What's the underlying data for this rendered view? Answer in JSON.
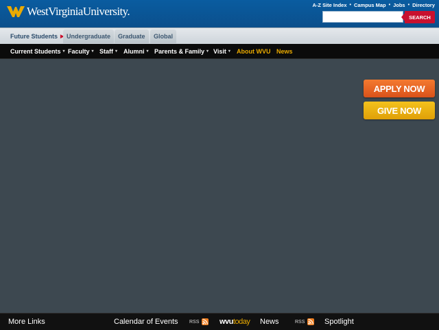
{
  "header": {
    "logo_text": "WestVirginiaUniversity.",
    "util_links": [
      "A-Z Site Index",
      "Campus Map",
      "Jobs",
      "Directory"
    ],
    "search": {
      "placeholder": "",
      "button_label": "SEARCH"
    }
  },
  "audience_tabs": [
    "Future Students",
    "Undergraduate",
    "Graduate",
    "Global"
  ],
  "main_nav": [
    {
      "label": "Current Students",
      "dropdown": true
    },
    {
      "label": "Faculty",
      "dropdown": true
    },
    {
      "label": "Staff",
      "dropdown": true
    },
    {
      "label": "Alumni",
      "dropdown": true
    },
    {
      "label": "Parents & Family",
      "dropdown": true
    },
    {
      "label": "Visit",
      "dropdown": true
    },
    {
      "label": "About WVU",
      "dropdown": false
    },
    {
      "label": "News",
      "dropdown": false
    }
  ],
  "cta": {
    "apply": "APPLY NOW",
    "give": "GIVE NOW"
  },
  "footer": {
    "more_links": "More Links",
    "calendar": "Calendar of Events",
    "rss": "RSS",
    "wvutoday_a": "wvu",
    "wvutoday_b": "today",
    "news": "News",
    "spotlight": "Spotlight"
  },
  "colors": {
    "brand_blue": "#0b5595",
    "gold": "#eaaa00",
    "search_red": "#c8102e",
    "apply_orange": "#e8621f",
    "give_gold": "#f0b414",
    "page_bg": "#3d4850"
  },
  "icons": [
    "flying-wv-logo-icon",
    "caret-right-icon",
    "chevron-down-icon",
    "rss-icon"
  ]
}
